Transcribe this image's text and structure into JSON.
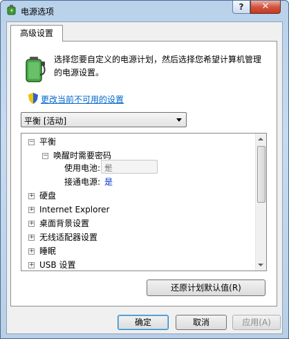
{
  "window": {
    "title": "电源选项",
    "help_label": "?",
    "close_label": "✕"
  },
  "tabs": [
    {
      "label": "高级设置"
    }
  ],
  "description": "选择您要自定义的电源计划，然后选择您希望计算机管理的电源设置。",
  "change_link": "更改当前不可用的设置",
  "plan_select": {
    "value": "平衡 [活动]"
  },
  "tree": {
    "items": [
      {
        "label": "平衡",
        "expander": "−"
      },
      {
        "label": "唤醒时需要密码",
        "expander": "−"
      },
      {
        "label": "使用电池:",
        "value": "是"
      },
      {
        "label": "接通电源:",
        "value": "是"
      },
      {
        "label": "硬盘",
        "expander": "+"
      },
      {
        "label": "Internet Explorer",
        "expander": "+"
      },
      {
        "label": "桌面背景设置",
        "expander": "+"
      },
      {
        "label": "无线适配器设置",
        "expander": "+"
      },
      {
        "label": "睡眠",
        "expander": "+"
      },
      {
        "label": "USB 设置",
        "expander": "+"
      }
    ]
  },
  "restore_button": "还原计划默认值(R)",
  "buttons": {
    "ok": "确定",
    "cancel": "取消",
    "apply": "应用(A)"
  },
  "colors": {
    "link": "#0066cc",
    "accent_value": "#0033cc"
  }
}
